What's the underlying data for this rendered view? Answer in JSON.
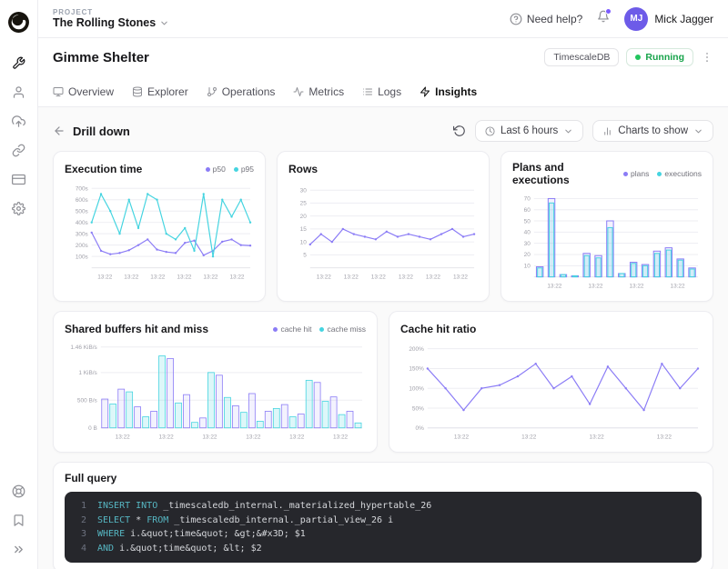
{
  "colors": {
    "purple": "#8b7cf6",
    "cyan": "#45d4e0",
    "green": "#22c55e",
    "avatar": "#6d5be8"
  },
  "sidebar": {
    "top_icons": [
      "timescale-logo",
      "services-wrench",
      "members-user",
      "import-cloud-upload",
      "integrations-link",
      "billing-credit-card",
      "settings-gear"
    ],
    "bottom_icons": [
      "support-life-buoy",
      "bookmark",
      "expand-chevrons-right"
    ]
  },
  "header": {
    "project_label": "PROJECT",
    "project_name": "The Rolling Stones",
    "help_label": "Need help?",
    "user_initials": "MJ",
    "user_name": "Mick Jagger"
  },
  "service": {
    "title": "Gimme Shelter",
    "db_badge": "TimescaleDB",
    "status_label": "Running"
  },
  "tabs": [
    {
      "label": "Overview"
    },
    {
      "label": "Explorer"
    },
    {
      "label": "Operations"
    },
    {
      "label": "Metrics"
    },
    {
      "label": "Logs"
    },
    {
      "label": "Insights"
    }
  ],
  "toolbar": {
    "back_label": "Drill down",
    "time_range": "Last 6 hours",
    "charts_label": "Charts to show"
  },
  "chart_data": [
    {
      "title": "Execution time",
      "type": "line",
      "padl": 30,
      "ymin": 0,
      "ymax": 730,
      "yticks": [
        {
          "v": 100,
          "label": "100s"
        },
        {
          "v": 200,
          "label": "200s"
        },
        {
          "v": 300,
          "label": "300s"
        },
        {
          "v": 400,
          "label": "400s"
        },
        {
          "v": 500,
          "label": "500s"
        },
        {
          "v": 600,
          "label": "600s"
        },
        {
          "v": 700,
          "label": "700s"
        }
      ],
      "xlabels": [
        "13:22",
        "13:22",
        "13:22",
        "13:22",
        "13:22",
        "13:22"
      ],
      "legend": [
        {
          "label": "p50",
          "color": "#8b7cf6"
        },
        {
          "label": "p95",
          "color": "#45d4e0"
        }
      ],
      "series": [
        {
          "name": "p50",
          "color": "#8b7cf6",
          "values": [
            310,
            150,
            120,
            130,
            155,
            200,
            250,
            160,
            140,
            130,
            220,
            240,
            110,
            150,
            230,
            250,
            200,
            195
          ]
        },
        {
          "name": "p95",
          "color": "#45d4e0",
          "values": [
            400,
            650,
            500,
            300,
            600,
            350,
            650,
            600,
            300,
            250,
            350,
            150,
            650,
            100,
            600,
            450,
            600,
            400
          ]
        }
      ]
    },
    {
      "title": "Rows",
      "type": "line",
      "padl": 24,
      "ymin": 0,
      "ymax": 32,
      "yticks": [
        {
          "v": 5,
          "label": "5"
        },
        {
          "v": 10,
          "label": "10"
        },
        {
          "v": 15,
          "label": "15"
        },
        {
          "v": 20,
          "label": "20"
        },
        {
          "v": 25,
          "label": "25"
        },
        {
          "v": 30,
          "label": "30"
        }
      ],
      "xlabels": [
        "13:22",
        "13:22",
        "13:22",
        "13:22",
        "13:22",
        "13:22"
      ],
      "legend": [],
      "series": [
        {
          "name": "rows",
          "color": "#8b7cf6",
          "values": [
            9,
            13,
            10,
            15,
            13,
            12,
            11,
            14,
            12,
            13,
            12,
            11,
            13,
            15,
            12,
            13
          ]
        }
      ]
    },
    {
      "title": "Plans and executions",
      "type": "bars",
      "padl": 24,
      "ymin": 0,
      "ymax": 74,
      "yticks": [
        {
          "v": 10,
          "label": "10"
        },
        {
          "v": 20,
          "label": "20"
        },
        {
          "v": 30,
          "label": "30"
        },
        {
          "v": 40,
          "label": "40"
        },
        {
          "v": 50,
          "label": "50"
        },
        {
          "v": 60,
          "label": "60"
        },
        {
          "v": 70,
          "label": "70"
        }
      ],
      "xlabels": [
        "13:22",
        "13:22",
        "13:22",
        "13:22"
      ],
      "legend": [
        {
          "label": "plans",
          "color": "#8b7cf6"
        },
        {
          "label": "executions",
          "color": "#45d4e0"
        }
      ],
      "series": [
        {
          "name": "plans",
          "color": "#8b7cf6",
          "fill": "rgba(139,124,246,0.10)",
          "values": [
            9,
            70,
            2,
            1,
            21,
            19,
            50,
            3,
            13,
            11,
            23,
            26,
            16,
            8
          ]
        },
        {
          "name": "executions",
          "color": "#45d4e0",
          "fill": "rgba(69,212,224,0.18)",
          "values": [
            8,
            66,
            2,
            1,
            19,
            17,
            44,
            3,
            12,
            10,
            21,
            24,
            15,
            7
          ]
        }
      ]
    },
    {
      "title": "Shared buffers hit and miss",
      "type": "bars-group",
      "padl": 40,
      "ymin": 0,
      "ymax": 1500,
      "yticks": [
        {
          "v": 0,
          "label": "0 B"
        },
        {
          "v": 500,
          "label": "500 B/s"
        },
        {
          "v": 1000,
          "label": "1 KiB/s"
        },
        {
          "v": 1460,
          "label": "1.46 KiB/s"
        }
      ],
      "xlabels": [
        "13:22",
        "13:22",
        "13:22",
        "13:22",
        "13:22",
        "13:22"
      ],
      "legend": [
        {
          "label": "cache hit",
          "color": "#8b7cf6"
        },
        {
          "label": "cache miss",
          "color": "#45d4e0"
        }
      ],
      "series": [
        {
          "name": "cache hit",
          "color": "#8b7cf6",
          "fill": "rgba(139,124,246,0.10)",
          "values": [
            520,
            700,
            380,
            300,
            1250,
            600,
            180,
            950,
            400,
            620,
            300,
            420,
            250,
            820,
            560,
            300
          ]
        },
        {
          "name": "cache miss",
          "color": "#45d4e0",
          "fill": "rgba(69,212,224,0.18)",
          "values": [
            430,
            650,
            200,
            1300,
            450,
            100,
            1000,
            550,
            280,
            120,
            350,
            200,
            860,
            480,
            240,
            90
          ]
        }
      ]
    },
    {
      "title": "Cache hit ratio",
      "type": "line",
      "padl": 30,
      "ymin": 0,
      "ymax": 210,
      "yticks": [
        {
          "v": 0,
          "label": "0%"
        },
        {
          "v": 50,
          "label": "50%"
        },
        {
          "v": 100,
          "label": "100%"
        },
        {
          "v": 150,
          "label": "150%"
        },
        {
          "v": 200,
          "label": "200%"
        }
      ],
      "xlabels": [
        "13:22",
        "13:22",
        "13:22",
        "13:22"
      ],
      "legend": [],
      "series": [
        {
          "name": "cache hit ratio",
          "color": "#8b7cf6",
          "values": [
            150,
            100,
            45,
            100,
            108,
            130,
            162,
            100,
            130,
            60,
            155,
            100,
            45,
            162,
            100,
            150
          ]
        }
      ]
    }
  ],
  "full_query": {
    "title": "Full query",
    "lines": [
      {
        "num": "1",
        "segments": [
          {
            "cls": "kw",
            "text": "INSERT INTO "
          },
          {
            "cls": "pl",
            "text": "_timescaledb_internal._materialized_hypertable_26"
          }
        ]
      },
      {
        "num": "2",
        "segments": [
          {
            "cls": "kw",
            "text": "SELECT"
          },
          {
            "cls": "pl",
            "text": " * "
          },
          {
            "cls": "kw",
            "text": "FROM"
          },
          {
            "cls": "pl",
            "text": " _timescaledb_internal._partial_view_26 i"
          }
        ]
      },
      {
        "num": "3",
        "segments": [
          {
            "cls": "kw",
            "text": "WHERE"
          },
          {
            "cls": "pl",
            "text": " i.&quot;time&quot; &gt;&#x3D; $1"
          }
        ]
      },
      {
        "num": "4",
        "segments": [
          {
            "cls": "kw",
            "text": "AND"
          },
          {
            "cls": "pl",
            "text": " i.&quot;time&quot; &lt; $2"
          }
        ]
      }
    ]
  }
}
